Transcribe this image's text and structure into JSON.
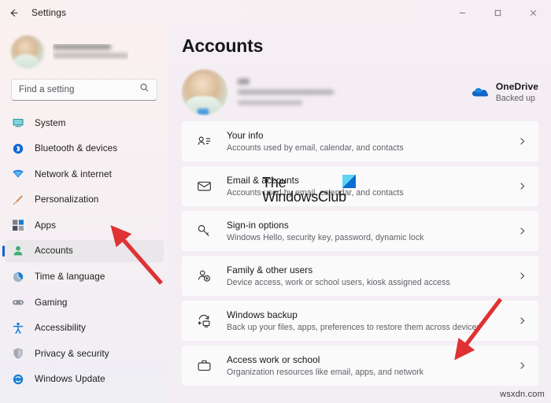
{
  "window": {
    "title": "Settings",
    "back_icon": "back-arrow-icon",
    "minimize_label": "Minimize",
    "maximize_label": "Maximize",
    "close_label": "Close"
  },
  "sidebar": {
    "profile": {
      "name_redacted": "",
      "email_redacted": "",
      "avatar_label": "user-avatar"
    },
    "search": {
      "placeholder": "Find a setting",
      "value": "",
      "icon": "search-icon"
    },
    "items": [
      {
        "label": "System",
        "icon": "monitor-icon",
        "selected": false
      },
      {
        "label": "Bluetooth & devices",
        "icon": "bluetooth-icon",
        "selected": false
      },
      {
        "label": "Network & internet",
        "icon": "wifi-icon",
        "selected": false
      },
      {
        "label": "Personalization",
        "icon": "paintbrush-icon",
        "selected": false
      },
      {
        "label": "Apps",
        "icon": "apps-grid-icon",
        "selected": false
      },
      {
        "label": "Accounts",
        "icon": "person-icon",
        "selected": true
      },
      {
        "label": "Time & language",
        "icon": "clock-icon",
        "selected": false
      },
      {
        "label": "Gaming",
        "icon": "gamepad-icon",
        "selected": false
      },
      {
        "label": "Accessibility",
        "icon": "accessibility-icon",
        "selected": false
      },
      {
        "label": "Privacy & security",
        "icon": "shield-icon",
        "selected": false
      },
      {
        "label": "Windows Update",
        "icon": "update-sync-icon",
        "selected": false
      }
    ]
  },
  "main": {
    "page_title": "Accounts",
    "account": {
      "name_redacted": "",
      "email_redacted": "",
      "type_redacted": ""
    },
    "onedrive": {
      "name": "OneDrive",
      "status": "Backed up",
      "icon": "onedrive-cloud-icon"
    },
    "cards": [
      {
        "title": "Your info",
        "subtitle": "Accounts used by email, calendar, and contacts",
        "icon": "contact-card-icon",
        "chevron": "chevron-right-icon"
      },
      {
        "title": "Email & accounts",
        "subtitle": "Accounts used by email, calendar, and contacts",
        "icon": "envelope-icon",
        "chevron": "chevron-right-icon"
      },
      {
        "title": "Sign-in options",
        "subtitle": "Windows Hello, security key, password, dynamic lock",
        "icon": "key-icon",
        "chevron": "chevron-right-icon"
      },
      {
        "title": "Family & other users",
        "subtitle": "Device access, work or school users, kiosk assigned access",
        "icon": "person-add-icon",
        "chevron": "chevron-right-icon"
      },
      {
        "title": "Windows backup",
        "subtitle": "Back up your files, apps, preferences to restore them across devices",
        "icon": "backup-restore-icon",
        "chevron": "chevron-right-icon"
      },
      {
        "title": "Access work or school",
        "subtitle": "Organization resources like email, apps, and network",
        "icon": "briefcase-icon",
        "chevron": "chevron-right-icon"
      }
    ]
  },
  "overlays": {
    "watermark_line1": "The",
    "watermark_line2": "WindowsClub",
    "site_watermark": "wsxdn.com",
    "annotation_arrow_color": "#e03232",
    "arrow_1_target": "Accounts",
    "arrow_2_target": "Access work or school"
  },
  "colors": {
    "accent_blue": "#0f5fcd",
    "sidebar_top": "#faf1f0",
    "sidebar_bottom": "#f0eff4",
    "content_bg": "#f4eef4",
    "card_bg": "#fbfafb",
    "selected_row": "#e9e7ea"
  }
}
